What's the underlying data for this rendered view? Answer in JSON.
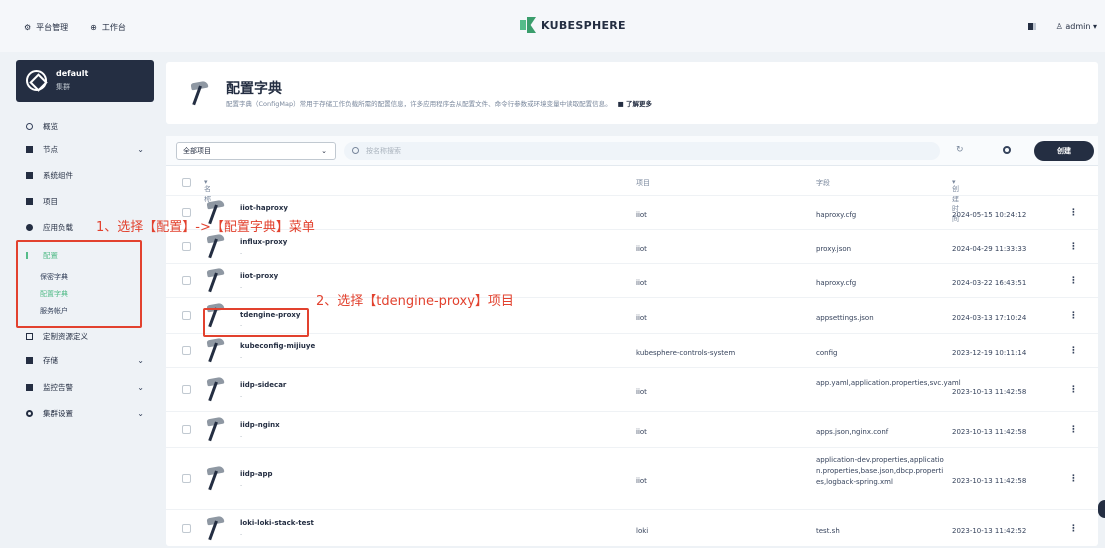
{
  "topbar": {
    "platform_label": "平台管理",
    "workbench_label": "工作台",
    "brand": "KUBESPHERE",
    "user": "admin"
  },
  "cluster": {
    "name": "default",
    "sub": "集群"
  },
  "sidebar": {
    "items": [
      {
        "label": "概览"
      },
      {
        "label": "节点"
      },
      {
        "label": "系统组件"
      },
      {
        "label": "项目"
      },
      {
        "label": "应用负载"
      },
      {
        "label": "配置"
      },
      {
        "label": "定制资源定义"
      },
      {
        "label": "存储"
      },
      {
        "label": "监控告警"
      },
      {
        "label": "集群设置"
      }
    ],
    "config_sub": [
      {
        "label": "保密字典"
      },
      {
        "label": "配置字典"
      },
      {
        "label": "服务帐户"
      }
    ]
  },
  "annotations": {
    "step1": "1、选择【配置】->【配置字典】菜单",
    "step2": "2、选择【tdengine-proxy】项目"
  },
  "header": {
    "title": "配置字典",
    "desc": "配置字典（ConfigMap）常用于存储工作负载所需的配置信息，许多应用程序会从配置文件、命令行参数或环境变量中读取配置信息。",
    "learn_more": "了解更多"
  },
  "toolbar": {
    "select_value": "全部项目",
    "search_placeholder": "按名称搜索",
    "create_label": "创建"
  },
  "table": {
    "headers": {
      "name": "名称",
      "project": "项目",
      "field": "字段",
      "created": "创建时间"
    },
    "rows": [
      {
        "name": "iiot-haproxy",
        "desc": "-",
        "project": "iiot",
        "field": "haproxy.cfg",
        "created": "2024-05-15 10:24:12"
      },
      {
        "name": "influx-proxy",
        "desc": "-",
        "project": "iiot",
        "field": "proxy.json",
        "created": "2024-04-29 11:33:33"
      },
      {
        "name": "iiot-proxy",
        "desc": "-",
        "project": "iiot",
        "field": "haproxy.cfg",
        "created": "2024-03-22 16:43:51"
      },
      {
        "name": "tdengine-proxy",
        "desc": "-",
        "project": "iiot",
        "field": "appsettings.json",
        "created": "2024-03-13 17:10:24"
      },
      {
        "name": "kubeconfig-mijiuye",
        "desc": "-",
        "project": "kubesphere-controls-system",
        "field": "config",
        "created": "2023-12-19 10:11:14"
      },
      {
        "name": "iidp-sidecar",
        "desc": "-",
        "project": "iiot",
        "field": "app.yaml,application.properties,svc.yaml",
        "created": "2023-10-13 11:42:58"
      },
      {
        "name": "iidp-nginx",
        "desc": "-",
        "project": "iiot",
        "field": "apps.json,nginx.conf",
        "created": "2023-10-13 11:42:58"
      },
      {
        "name": "iidp-app",
        "desc": "-",
        "project": "iiot",
        "field": "application-dev.properties,application.properties,base.json,dbcp.properties,logback-spring.xml",
        "created": "2023-10-13 11:42:58"
      },
      {
        "name": "loki-loki-stack-test",
        "desc": "-",
        "project": "loki",
        "field": "test.sh",
        "created": "2023-10-13 11:42:52"
      }
    ]
  },
  "colors": {
    "accent": "#55bc8a",
    "dark": "#242e42",
    "annotation": "#e2412e"
  }
}
